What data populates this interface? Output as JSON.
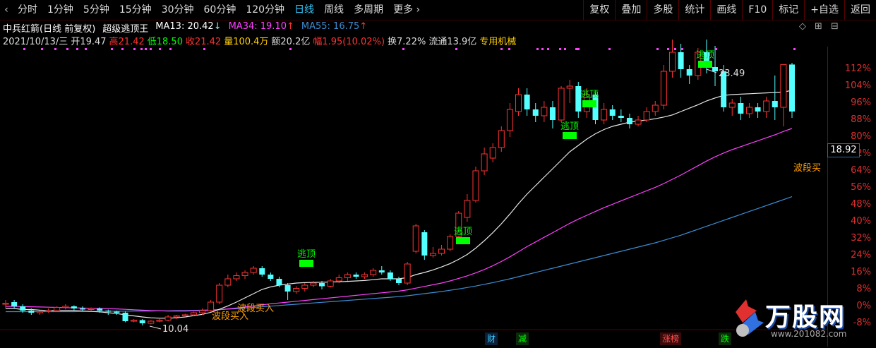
{
  "toolbar": {
    "periods": [
      "分时",
      "1分钟",
      "5分钟",
      "15分钟",
      "30分钟",
      "60分钟",
      "120分钟",
      "日线",
      "周线",
      "多周期",
      "更多"
    ],
    "active_period": "日线",
    "right_buttons": [
      "复权",
      "叠加",
      "多股",
      "统计",
      "画线",
      "F10",
      "标记",
      "+自选",
      "返回"
    ]
  },
  "stock": {
    "title": "中兵红箭(日线 前复权)",
    "indicator": "超级逃顶王",
    "ma13": "MA13: 20.42",
    "ma34": "MA34: 19.10",
    "ma55": "MA55: 16.75",
    "date": "2021/10/13/三",
    "open": "开19.47",
    "high": "高21.42",
    "low": "低18.50",
    "close": "收21.42",
    "volume": "量100.4万",
    "amount": "额20.2亿",
    "change": "幅1.95(10.02%)",
    "turnover": "换7.22%",
    "float": "流通13.9亿",
    "sector": "专用机械"
  },
  "colors": {
    "up": "#ff3232",
    "down": "#54ffff",
    "ma13": "#e8e8e8",
    "ma34": "#ff40ff",
    "ma55": "#3c8cd2",
    "escape": "#00ff00",
    "buy": "#ffa000"
  },
  "y_axis": [
    "112%",
    "104%",
    "96%",
    "88%",
    "80%",
    "72%",
    "64%",
    "56%",
    "48%",
    "40%",
    "32%",
    "24%",
    "16%",
    "8%",
    "0%",
    "-8%"
  ],
  "current_price": "18.92",
  "annotations": {
    "low_price": "10.04",
    "high_price": "23.49",
    "escape_label": "逃顶",
    "buy_label": "波段买入",
    "buy_label_short": "波段买"
  },
  "events": [
    "财",
    "减",
    "涨榜",
    "跌"
  ],
  "logo": {
    "text": "万股网",
    "url": "www.201082.com"
  },
  "candles": [
    [
      10.1,
      10.15,
      9.9,
      10.3
    ],
    [
      10.2,
      10.0,
      9.9,
      10.3
    ],
    [
      10.0,
      9.8,
      9.7,
      10.1
    ],
    [
      9.8,
      9.7,
      9.6,
      9.9
    ],
    [
      9.7,
      9.75,
      9.6,
      9.8
    ],
    [
      9.75,
      9.8,
      9.7,
      9.9
    ],
    [
      9.8,
      9.95,
      9.75,
      10.0
    ],
    [
      9.95,
      10.0,
      9.85,
      10.1
    ],
    [
      10.0,
      9.9,
      9.8,
      10.05
    ],
    [
      9.9,
      9.85,
      9.75,
      10.0
    ],
    [
      9.85,
      9.9,
      9.8,
      9.95
    ],
    [
      9.9,
      9.8,
      9.7,
      9.95
    ],
    [
      9.8,
      9.75,
      9.6,
      9.85
    ],
    [
      9.75,
      9.7,
      9.6,
      9.8
    ],
    [
      9.7,
      9.3,
      9.25,
      9.75
    ],
    [
      9.3,
      9.35,
      9.25,
      9.4
    ],
    [
      9.35,
      9.2,
      9.1,
      9.4
    ],
    [
      9.2,
      9.3,
      9.15,
      9.35
    ],
    [
      9.3,
      9.35,
      9.25,
      9.4
    ],
    [
      9.35,
      9.5,
      9.3,
      9.6
    ],
    [
      9.5,
      9.55,
      9.4,
      9.6
    ],
    [
      9.55,
      9.6,
      9.5,
      9.65
    ],
    [
      9.6,
      9.7,
      9.55,
      9.75
    ],
    [
      9.7,
      9.8,
      9.6,
      9.9
    ],
    [
      9.8,
      10.2,
      9.75,
      10.3
    ],
    [
      10.2,
      11.0,
      10.1,
      11.1
    ],
    [
      11.0,
      11.3,
      10.9,
      11.5
    ],
    [
      11.3,
      11.45,
      11.2,
      11.6
    ],
    [
      11.45,
      11.6,
      11.3,
      11.7
    ],
    [
      11.6,
      11.8,
      11.5,
      11.9
    ],
    [
      11.8,
      11.5,
      11.4,
      11.9
    ],
    [
      11.5,
      11.3,
      11.2,
      11.6
    ],
    [
      11.3,
      11.0,
      10.9,
      11.4
    ],
    [
      11.0,
      10.7,
      10.3,
      11.1
    ],
    [
      10.7,
      10.85,
      10.6,
      10.95
    ],
    [
      10.85,
      11.0,
      10.7,
      11.1
    ],
    [
      11.0,
      11.1,
      10.9,
      11.2
    ],
    [
      11.1,
      10.95,
      10.8,
      11.2
    ],
    [
      10.95,
      11.2,
      10.9,
      11.3
    ],
    [
      11.2,
      11.35,
      11.1,
      11.5
    ],
    [
      11.35,
      11.5,
      11.2,
      11.6
    ],
    [
      11.5,
      11.4,
      11.3,
      11.6
    ],
    [
      11.4,
      11.5,
      11.3,
      11.6
    ],
    [
      11.5,
      11.7,
      11.4,
      11.8
    ],
    [
      11.7,
      11.6,
      11.5,
      11.9
    ],
    [
      11.6,
      11.3,
      11.2,
      11.7
    ],
    [
      11.3,
      11.1,
      11.0,
      11.4
    ],
    [
      11.1,
      12.0,
      11.0,
      12.1
    ],
    [
      12.6,
      13.8,
      12.5,
      13.9
    ],
    [
      13.5,
      12.4,
      12.2,
      13.6
    ],
    [
      12.4,
      12.5,
      12.3,
      12.8
    ],
    [
      12.5,
      12.7,
      12.4,
      12.9
    ],
    [
      12.7,
      13.3,
      12.6,
      13.4
    ],
    [
      13.3,
      14.4,
      13.2,
      14.5
    ],
    [
      14.2,
      15.0,
      14.0,
      15.3
    ],
    [
      15.0,
      16.4,
      14.9,
      16.6
    ],
    [
      16.4,
      17.2,
      16.2,
      17.5
    ],
    [
      17.0,
      17.5,
      16.8,
      17.7
    ],
    [
      17.5,
      18.3,
      17.3,
      18.5
    ],
    [
      18.3,
      19.3,
      18.0,
      19.6
    ],
    [
      19.2,
      20.0,
      19.0,
      20.3
    ],
    [
      20.0,
      19.3,
      19.0,
      20.3
    ],
    [
      19.3,
      19.0,
      18.7,
      19.6
    ],
    [
      19.0,
      19.4,
      18.7,
      19.7
    ],
    [
      19.4,
      18.8,
      18.4,
      19.7
    ],
    [
      18.8,
      20.3,
      18.7,
      20.4
    ],
    [
      20.3,
      20.4,
      19.6,
      20.7
    ],
    [
      20.4,
      19.2,
      18.9,
      20.6
    ],
    [
      19.2,
      20.0,
      18.9,
      20.3
    ],
    [
      20.0,
      18.8,
      18.6,
      20.1
    ],
    [
      18.8,
      19.3,
      18.6,
      19.6
    ],
    [
      19.3,
      19.0,
      18.8,
      19.5
    ],
    [
      19.0,
      18.9,
      18.7,
      19.3
    ],
    [
      18.9,
      18.6,
      18.4,
      19.1
    ],
    [
      18.6,
      18.8,
      18.5,
      19.0
    ],
    [
      18.8,
      19.2,
      18.7,
      19.4
    ],
    [
      19.2,
      19.5,
      19.0,
      19.7
    ],
    [
      19.5,
      21.1,
      19.3,
      21.4
    ],
    [
      21.1,
      22.0,
      20.8,
      22.6
    ],
    [
      22.0,
      21.2,
      20.8,
      22.4
    ],
    [
      21.2,
      20.9,
      20.5,
      21.4
    ],
    [
      20.9,
      22.0,
      20.7,
      22.2
    ],
    [
      22.0,
      21.3,
      21.0,
      22.6
    ],
    [
      21.3,
      21.1,
      20.4,
      22.3
    ],
    [
      21.1,
      19.4,
      19.2,
      21.4
    ],
    [
      19.4,
      19.6,
      19.0,
      19.8
    ],
    [
      19.6,
      19.1,
      18.8,
      19.9
    ],
    [
      19.1,
      19.4,
      18.9,
      19.6
    ],
    [
      19.4,
      19.2,
      18.9,
      19.6
    ],
    [
      19.2,
      19.7,
      18.9,
      19.9
    ],
    [
      19.7,
      19.4,
      18.8,
      20.9
    ],
    [
      19.4,
      21.42,
      18.5,
      21.42
    ],
    [
      21.42,
      19.2,
      18.9,
      21.5
    ]
  ],
  "ma13": [
    9.9,
    9.9,
    9.85,
    9.85,
    9.82,
    9.8,
    9.8,
    9.8,
    9.8,
    9.78,
    9.76,
    9.74,
    9.7,
    9.66,
    9.6,
    9.55,
    9.5,
    9.46,
    9.44,
    9.44,
    9.46,
    9.5,
    9.56,
    9.62,
    9.72,
    9.86,
    10.02,
    10.2,
    10.4,
    10.6,
    10.8,
    10.92,
    11.0,
    11.05,
    11.1,
    11.12,
    11.13,
    11.14,
    11.15,
    11.16,
    11.18,
    11.2,
    11.22,
    11.26,
    11.3,
    11.3,
    11.3,
    11.36,
    11.5,
    11.6,
    11.72,
    11.86,
    12.02,
    12.22,
    12.45,
    12.75,
    13.1,
    13.48,
    13.9,
    14.36,
    14.85,
    15.3,
    15.7,
    16.1,
    16.5,
    16.9,
    17.3,
    17.6,
    17.9,
    18.15,
    18.35,
    18.5,
    18.6,
    18.7,
    18.75,
    18.8,
    18.86,
    18.94,
    19.04,
    19.2,
    19.36,
    19.52,
    19.7,
    19.84,
    19.96,
    20.0,
    20.02,
    20.04,
    20.06,
    20.08,
    20.1,
    20.12,
    20.2
  ],
  "ma34": [
    10.0,
    10.0,
    9.99,
    9.98,
    9.97,
    9.96,
    9.95,
    9.94,
    9.93,
    9.92,
    9.91,
    9.9,
    9.89,
    9.88,
    9.86,
    9.84,
    9.82,
    9.8,
    9.79,
    9.78,
    9.78,
    9.78,
    9.79,
    9.8,
    9.82,
    9.84,
    9.88,
    9.92,
    9.97,
    10.02,
    10.07,
    10.12,
    10.16,
    10.2,
    10.24,
    10.28,
    10.32,
    10.36,
    10.4,
    10.44,
    10.48,
    10.52,
    10.56,
    10.6,
    10.64,
    10.68,
    10.72,
    10.78,
    10.86,
    10.94,
    11.02,
    11.1,
    11.2,
    11.32,
    11.44,
    11.58,
    11.74,
    11.92,
    12.12,
    12.34,
    12.58,
    12.82,
    13.04,
    13.26,
    13.48,
    13.7,
    13.92,
    14.12,
    14.3,
    14.48,
    14.66,
    14.82,
    14.98,
    15.14,
    15.3,
    15.46,
    15.62,
    15.8,
    16.0,
    16.2,
    16.42,
    16.64,
    16.86,
    17.06,
    17.24,
    17.4,
    17.54,
    17.68,
    17.82,
    17.96,
    18.1,
    18.26,
    18.4
  ],
  "ma55": [
    9.75,
    9.75,
    9.75,
    9.75,
    9.75,
    9.75,
    9.75,
    9.75,
    9.75,
    9.76,
    9.76,
    9.76,
    9.77,
    9.77,
    9.77,
    9.78,
    9.78,
    9.78,
    9.79,
    9.79,
    9.8,
    9.8,
    9.81,
    9.82,
    9.83,
    9.85,
    9.87,
    9.89,
    9.92,
    9.95,
    9.98,
    10.01,
    10.04,
    10.07,
    10.1,
    10.13,
    10.16,
    10.19,
    10.22,
    10.25,
    10.28,
    10.31,
    10.34,
    10.37,
    10.4,
    10.43,
    10.46,
    10.5,
    10.55,
    10.6,
    10.65,
    10.7,
    10.76,
    10.82,
    10.89,
    10.96,
    11.04,
    11.12,
    11.21,
    11.3,
    11.4,
    11.5,
    11.6,
    11.7,
    11.8,
    11.9,
    12.0,
    12.1,
    12.2,
    12.3,
    12.4,
    12.5,
    12.6,
    12.7,
    12.8,
    12.9,
    13.0,
    13.12,
    13.24,
    13.36,
    13.5,
    13.64,
    13.78,
    13.92,
    14.06,
    14.2,
    14.34,
    14.48,
    14.62,
    14.76,
    14.9,
    15.04,
    15.18
  ]
}
